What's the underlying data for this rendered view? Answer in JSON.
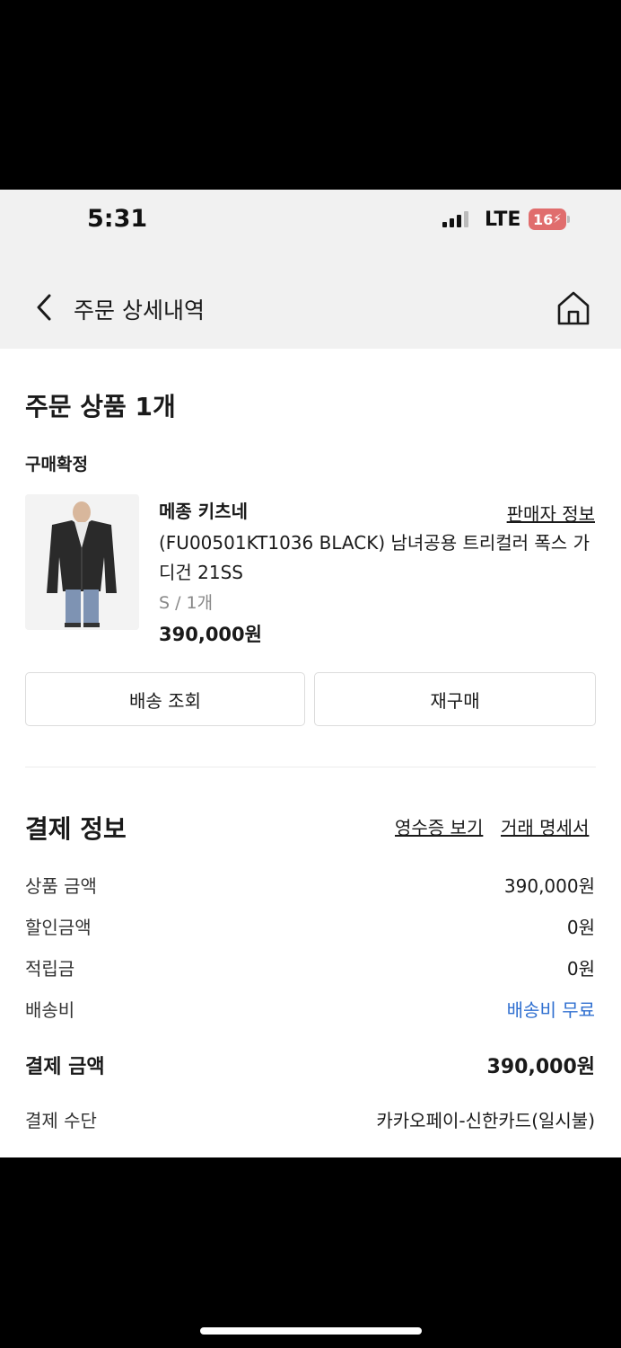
{
  "status_bar": {
    "time": "5:31",
    "network": "LTE",
    "battery": "16"
  },
  "nav": {
    "title": "주문 상세내역",
    "back_icon": "chevron-left-icon",
    "home_icon": "home-icon"
  },
  "order": {
    "section_title": "주문 상품 1개",
    "status": "구매확정",
    "product": {
      "brand": "메종 키츠네",
      "seller_info_label": "판매자 정보",
      "name": "(FU00501KT1036 BLACK) 남녀공용 트리컬러 폭스 가디건 21SS",
      "option": "S / 1개",
      "price": "390,000원"
    },
    "buttons": {
      "track_delivery": "배송 조회",
      "reorder": "재구매"
    }
  },
  "payment": {
    "section_title": "결제 정보",
    "receipt_link": "영수증 보기",
    "statement_link": "거래 명세서",
    "rows": [
      {
        "label": "상품 금액",
        "value": "390,000원"
      },
      {
        "label": "할인금액",
        "value": "0원"
      },
      {
        "label": "적립금",
        "value": "0원"
      },
      {
        "label": "배송비",
        "value": "배송비 무료"
      }
    ],
    "total_label": "결제 금액",
    "total_value": "390,000원",
    "method_label": "결제 수단",
    "method_value": "카카오페이-신한카드(일시불)"
  },
  "colors": {
    "accent_blue": "#2f6fd0",
    "battery_low": "#e06d6d"
  }
}
